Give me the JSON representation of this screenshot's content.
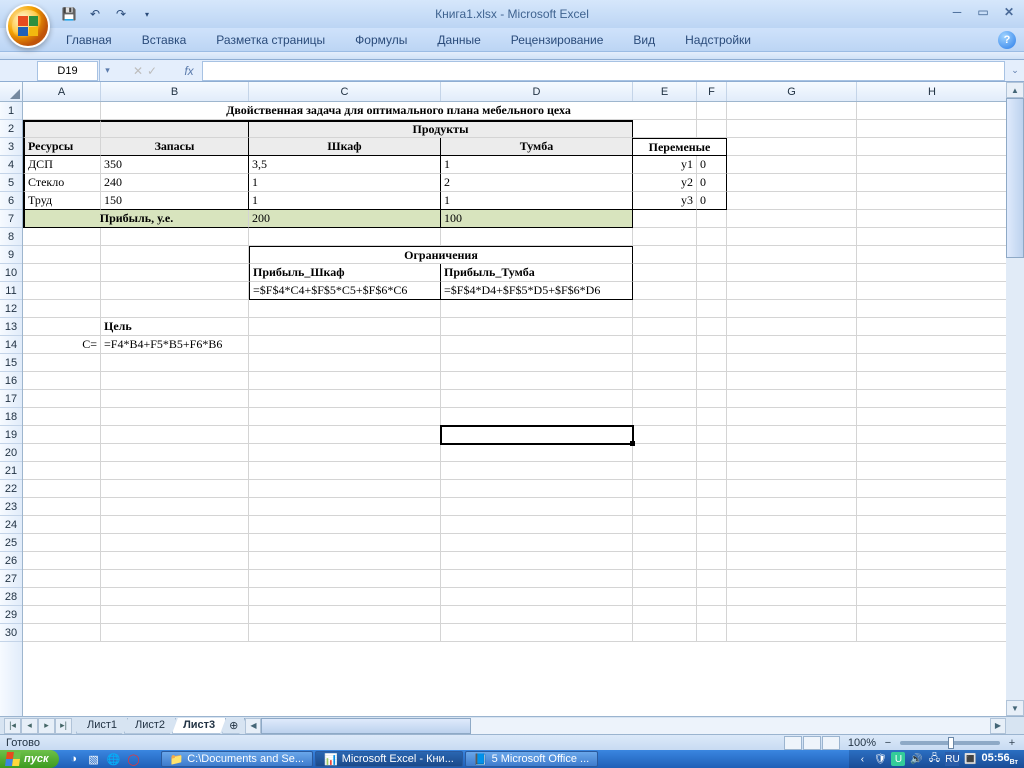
{
  "app_title": "Книга1.xlsx - Microsoft Excel",
  "ribbon_tabs": [
    "Главная",
    "Вставка",
    "Разметка страницы",
    "Формулы",
    "Данные",
    "Рецензирование",
    "Вид",
    "Надстройки"
  ],
  "name_box": "D19",
  "formula_value": "",
  "status_text": "Готово",
  "zoom_pct": "100%",
  "sheet_tabs": [
    "Лист1",
    "Лист2",
    "Лист3"
  ],
  "active_sheet": 2,
  "column_letters": [
    "A",
    "B",
    "C",
    "D",
    "E",
    "F",
    "G",
    "H"
  ],
  "row_count": 30,
  "active_cell": "D19",
  "cells": {
    "title_merged": "Двойственная задача для оптимального плана мебельного цеха",
    "products_header": "Продукты",
    "resources_header": "Ресурсы",
    "stocks_header": "Запасы",
    "shkaf_header": "Шкаф",
    "tumba_header": "Тумба",
    "vars_header": "Переменые",
    "r4": {
      "A": "ДСП",
      "B": "350",
      "C": "3,5",
      "D": "1",
      "E": "y1",
      "F": "0"
    },
    "r5": {
      "A": "Стекло",
      "B": "240",
      "C": "1",
      "D": "2",
      "E": "y2",
      "F": "0"
    },
    "r6": {
      "A": "Труд",
      "B": "150",
      "C": "1",
      "D": "1",
      "E": "y3",
      "F": "0"
    },
    "profit_label": "Прибыль, у.е.",
    "profit_C": "200",
    "profit_D": "100",
    "constraints_header": "Ограничения",
    "constr_C10": "Прибыль_Шкаф",
    "constr_D10": "Прибыль_Тумба",
    "constr_C11": "=$F$4*C4+$F$5*C5+$F$6*C6",
    "constr_D11": "=$F$4*D4+$F$5*D5+$F$6*D6",
    "goal_label": "Цель",
    "c_eq": "C=",
    "goal_formula": "=F4*B4+F5*B5+F6*B6"
  },
  "taskbar": {
    "start": "пуск",
    "items": [
      {
        "label": "C:\\Documents and Se..."
      },
      {
        "label": "Microsoft Excel - Кни..."
      },
      {
        "label": "5 Microsoft Office ..."
      }
    ],
    "clock": "05:56",
    "clock_day": "Вт"
  }
}
